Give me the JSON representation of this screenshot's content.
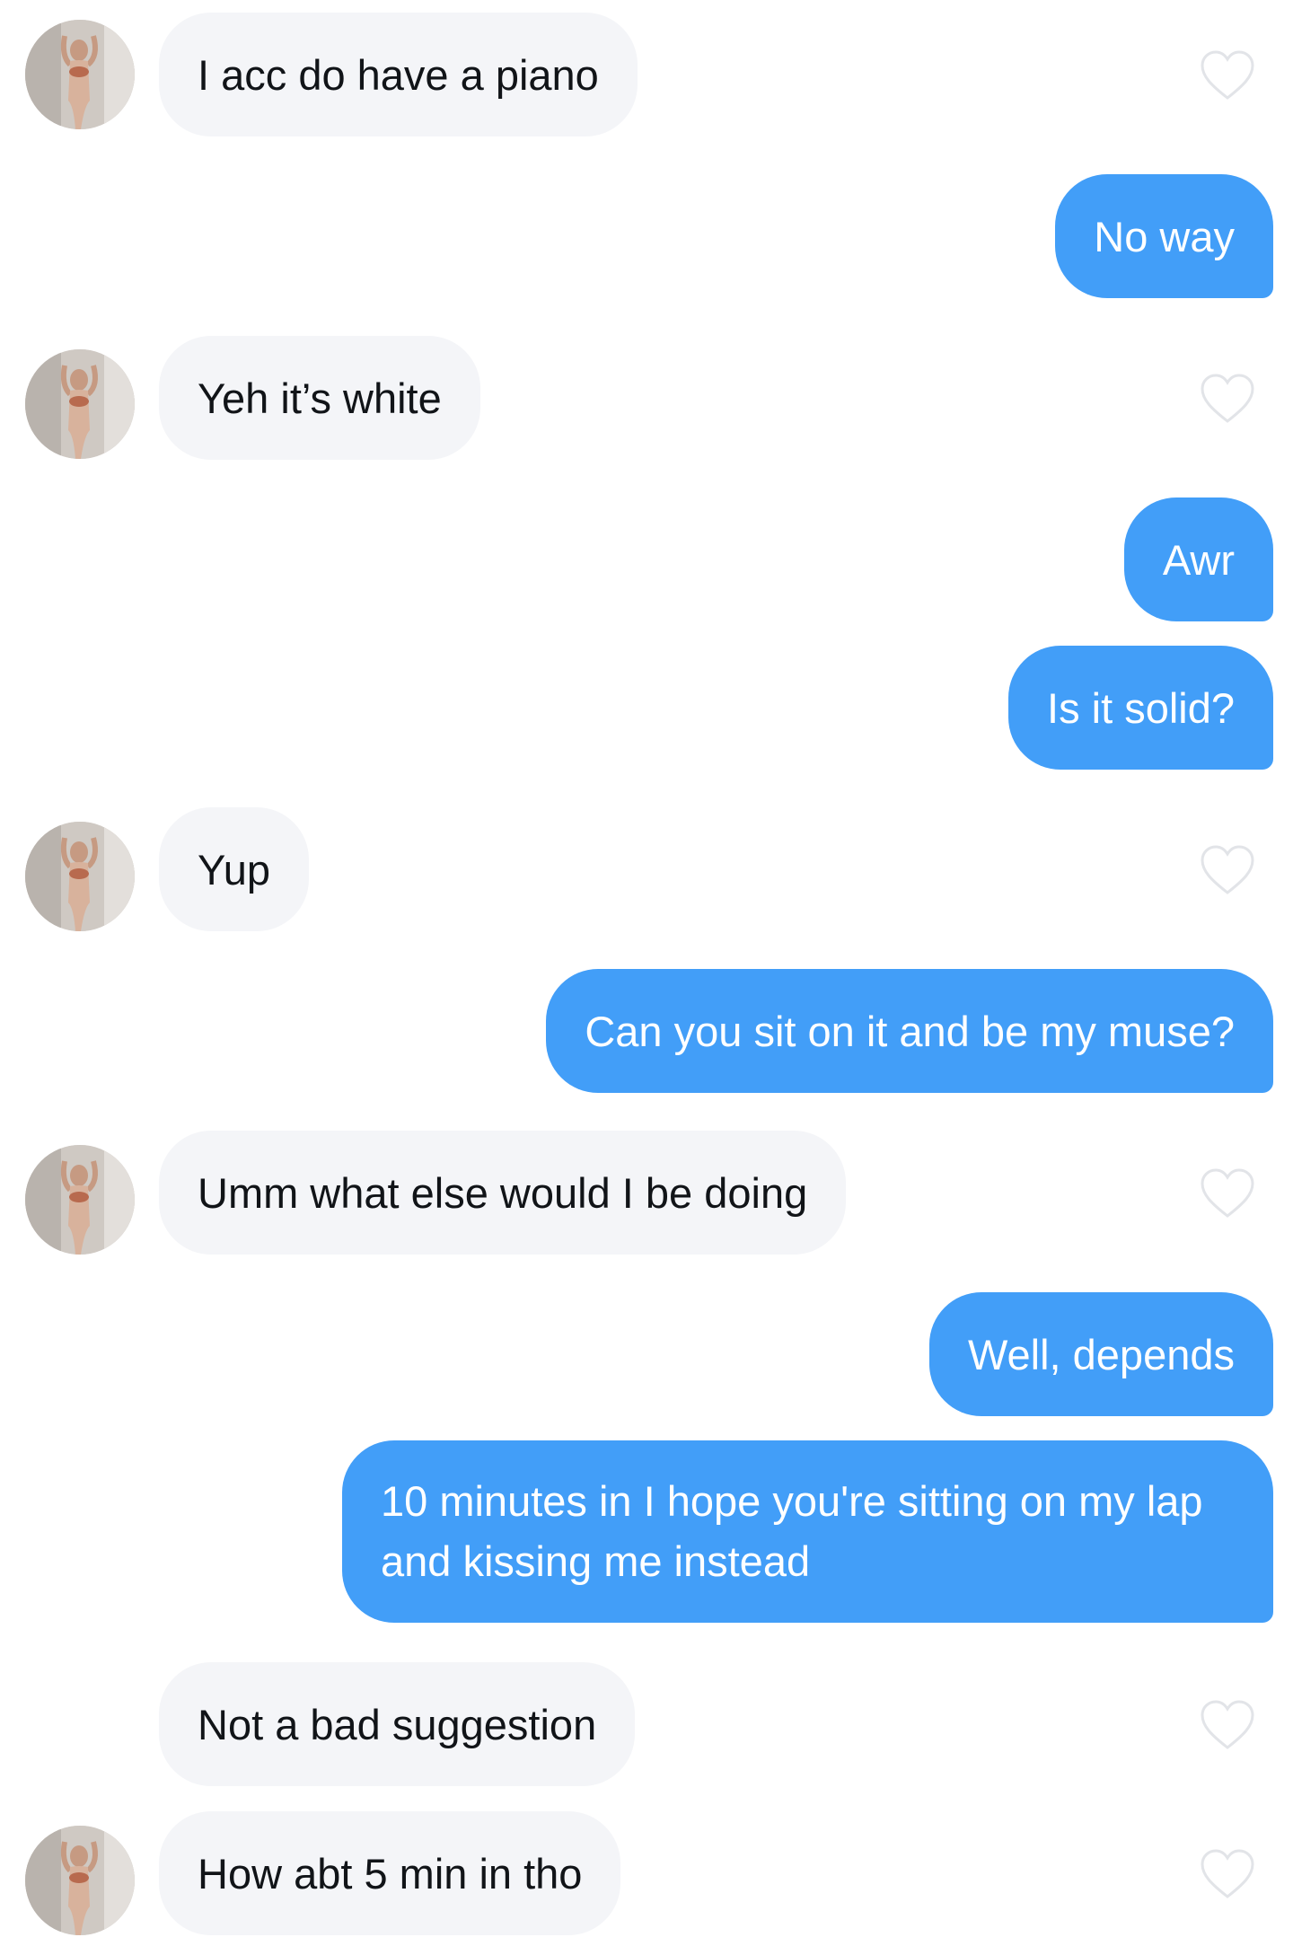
{
  "colors": {
    "outgoing_bubble": "#429ef8",
    "incoming_bubble": "#f4f5f8",
    "like_outline": "#e2e4e8"
  },
  "icons": {
    "like": "heart-outline-icon",
    "avatar": "profile-photo"
  },
  "messages": [
    {
      "side": "incoming",
      "text": "I acc do have a piano",
      "avatar": true
    },
    {
      "side": "outgoing",
      "text": "No way"
    },
    {
      "side": "incoming",
      "text": "Yeh it’s white",
      "avatar": true
    },
    {
      "side": "outgoing",
      "text": "Awr"
    },
    {
      "side": "outgoing",
      "text": "Is it solid?"
    },
    {
      "side": "incoming",
      "text": "Yup",
      "avatar": true
    },
    {
      "side": "outgoing",
      "text": "Can you sit on it and be my muse?"
    },
    {
      "side": "incoming",
      "text": "Umm what else would I be doing",
      "avatar": true
    },
    {
      "side": "outgoing",
      "text": "Well, depends"
    },
    {
      "side": "outgoing",
      "text": "10 minutes in I hope you're sitting on my lap and kissing me instead"
    },
    {
      "side": "incoming",
      "text": "Not a bad suggestion",
      "avatar": false
    },
    {
      "side": "incoming",
      "text": "How abt 5 min in tho",
      "avatar": true
    }
  ]
}
